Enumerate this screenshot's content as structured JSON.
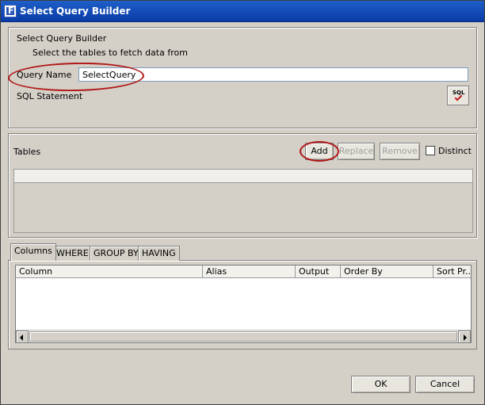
{
  "window": {
    "title": "Select Query Builder"
  },
  "header": {
    "heading": "Select Query Builder",
    "subheading": "Select the tables to fetch data from"
  },
  "query": {
    "name_label": "Query Name",
    "name_value": "SelectQuery",
    "sql_label": "SQL Statement",
    "sql_button_text": "SQL"
  },
  "tables": {
    "label": "Tables",
    "add_label": "Add",
    "replace_label": "Replace",
    "remove_label": "Remove",
    "distinct_label": "Distinct",
    "distinct_checked": false
  },
  "tabs": [
    {
      "label": "Columns",
      "active": true
    },
    {
      "label": "WHERE",
      "active": false
    },
    {
      "label": "GROUP BY",
      "active": false
    },
    {
      "label": "HAVING",
      "active": false
    }
  ],
  "grid": {
    "columns": [
      "Column",
      "Alias",
      "Output",
      "Order By",
      "Sort Pr..."
    ]
  },
  "footer": {
    "ok_label": "OK",
    "cancel_label": "Cancel"
  },
  "colors": {
    "annotation": "#b01818",
    "titlebar": "#0a3aa6"
  }
}
